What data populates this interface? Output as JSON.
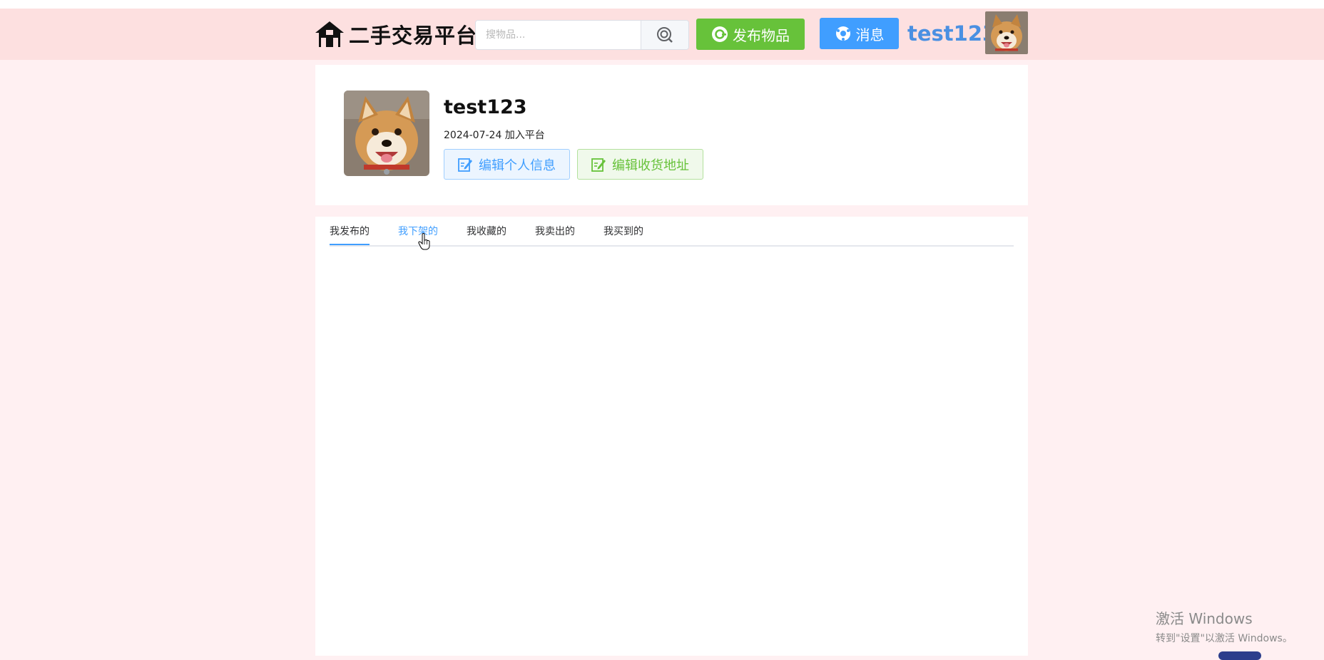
{
  "header": {
    "logo_text": "二手交易平台",
    "search_placeholder": "搜物品...",
    "publish_label": "发布物品",
    "message_label": "消息",
    "username": "test123"
  },
  "profile": {
    "name": "test123",
    "joined": "2024-07-24 加入平台",
    "edit_info_label": "编辑个人信息",
    "edit_address_label": "编辑收货地址"
  },
  "tabs": [
    {
      "label": "我发布的",
      "active": true
    },
    {
      "label": "我下架的",
      "hovered": true
    },
    {
      "label": "我收藏的"
    },
    {
      "label": "我卖出的"
    },
    {
      "label": "我买到的"
    }
  ],
  "watermark": {
    "line1": "激活 Windows",
    "line2": "转到\"设置\"以激活 Windows。"
  },
  "colors": {
    "accent_blue": "#409eff",
    "accent_green": "#67c23a",
    "header_bg": "#fde0e0",
    "page_bg": "#fff0f2"
  }
}
